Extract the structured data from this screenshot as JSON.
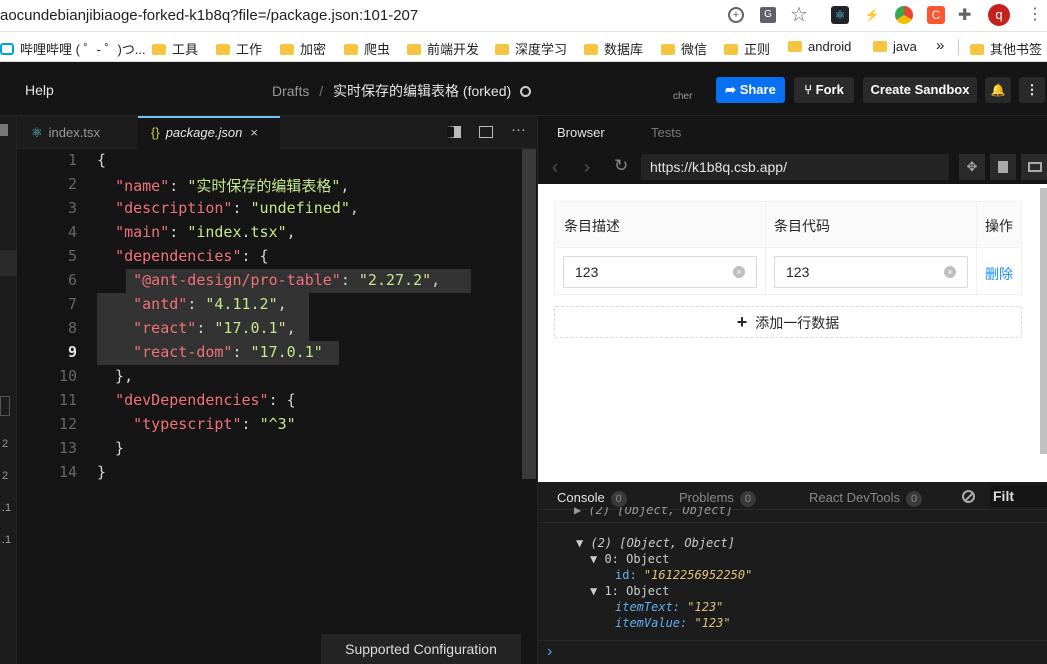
{
  "chrome": {
    "url": "aocundebianjibiaoge-forked-k1b8q?file=/package.json:101-207",
    "profile_initial": "q",
    "bookmarks": [
      {
        "label": "哔哩哔哩 ( ゜- ゜)つ..."
      },
      {
        "label": "工具"
      },
      {
        "label": "工作"
      },
      {
        "label": "加密"
      },
      {
        "label": "爬虫"
      },
      {
        "label": "前端开发"
      },
      {
        "label": "深度学习"
      },
      {
        "label": "数据库"
      },
      {
        "label": "微信"
      },
      {
        "label": "正则"
      },
      {
        "label": "android"
      },
      {
        "label": "java"
      }
    ],
    "more_bookmarks": "»",
    "other_bookmarks": "其他书签"
  },
  "header": {
    "menu_help": "Help",
    "breadcrumb_root": "Drafts",
    "breadcrumb_sep": "/",
    "sandbox_title": "实时保存的编辑表格 (forked)",
    "avatar_alt": "cher",
    "share_label": "Share",
    "fork_label": "Fork",
    "create_label": "Create Sandbox"
  },
  "editor": {
    "tabs": [
      {
        "label": "index.tsx",
        "active": false
      },
      {
        "label": "package.json",
        "active": true
      }
    ],
    "close_glyph": "×",
    "lines": [
      "1",
      "2",
      "3",
      "4",
      "5",
      "6",
      "7",
      "8",
      "9",
      "10",
      "11",
      "12",
      "13",
      "14"
    ],
    "status_bar": "Supported Configuration"
  },
  "browser": {
    "tab_browser": "Browser",
    "tab_tests": "Tests",
    "address": "https://k1b8q.csb.app/",
    "table": {
      "headers": [
        "条目描述",
        "条目代码",
        "操作"
      ],
      "row": {
        "desc": "123",
        "code": "123",
        "action": "删除"
      },
      "add_row_label": "添加一行数据",
      "add_icon": "+"
    }
  },
  "console": {
    "tabs": [
      {
        "label": "Console",
        "count": "0"
      },
      {
        "label": "Problems",
        "count": "0"
      },
      {
        "label": "React DevTools",
        "count": "0"
      }
    ],
    "filter_label": "Filt",
    "log": {
      "truncated": "▶ (2) [Object, Object]",
      "summary": "(2)  [Object, Object]",
      "item0": "0: Object",
      "id_key": "id:",
      "id_val": "\"1612256952250\"",
      "item1": "1: Object",
      "text_key": "itemText:",
      "text_val": "\"123\"",
      "value_key": "itemValue:",
      "value_val": "\"123\""
    },
    "prompt": "›"
  },
  "colors": {
    "share_button": "#0971f1",
    "json_key": "#f07178",
    "json_string": "#c3e88d",
    "link_blue": "#1890ff"
  }
}
